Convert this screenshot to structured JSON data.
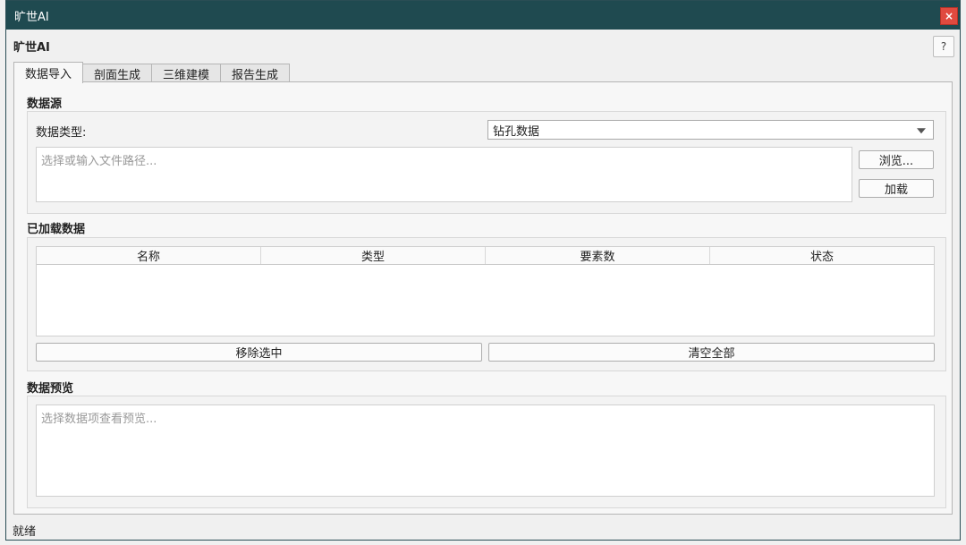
{
  "window": {
    "title": "旷世AI",
    "close_label": "×"
  },
  "app": {
    "heading": "旷世AI",
    "help_label": "?"
  },
  "tabs": [
    {
      "label": "数据导入"
    },
    {
      "label": "剖面生成"
    },
    {
      "label": "三维建模"
    },
    {
      "label": "报告生成"
    }
  ],
  "data_source": {
    "title": "数据源",
    "type_label": "数据类型:",
    "type_value": "钻孔数据",
    "path_placeholder": "选择或输入文件路径...",
    "browse_label": "浏览...",
    "load_label": "加载"
  },
  "loaded_data": {
    "title": "已加载数据",
    "columns": [
      "名称",
      "类型",
      "要素数",
      "状态"
    ],
    "rows": [],
    "remove_selected_label": "移除选中",
    "clear_all_label": "清空全部"
  },
  "preview": {
    "title": "数据预览",
    "placeholder": "选择数据项查看预览..."
  },
  "status": {
    "text": "就绪"
  },
  "colors": {
    "titlebar": "#1f4a50",
    "close": "#e04a3f"
  }
}
